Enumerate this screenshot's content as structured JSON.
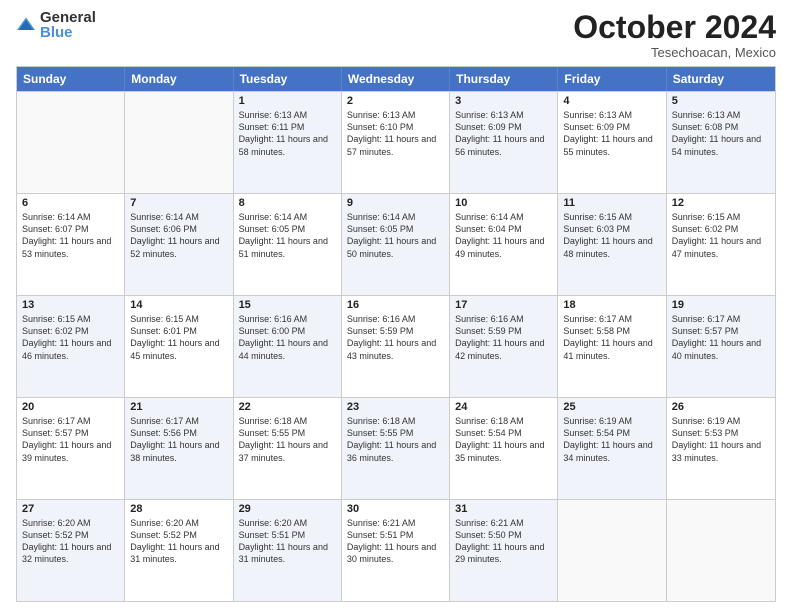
{
  "logo": {
    "general": "General",
    "blue": "Blue"
  },
  "title": "October 2024",
  "subtitle": "Tesechoacan, Mexico",
  "days": [
    "Sunday",
    "Monday",
    "Tuesday",
    "Wednesday",
    "Thursday",
    "Friday",
    "Saturday"
  ],
  "weeks": [
    [
      {
        "day": "",
        "sunrise": "",
        "sunset": "",
        "daylight": "",
        "shaded": false,
        "empty": true
      },
      {
        "day": "",
        "sunrise": "",
        "sunset": "",
        "daylight": "",
        "shaded": false,
        "empty": true
      },
      {
        "day": "1",
        "sunrise": "Sunrise: 6:13 AM",
        "sunset": "Sunset: 6:11 PM",
        "daylight": "Daylight: 11 hours and 58 minutes.",
        "shaded": true,
        "empty": false
      },
      {
        "day": "2",
        "sunrise": "Sunrise: 6:13 AM",
        "sunset": "Sunset: 6:10 PM",
        "daylight": "Daylight: 11 hours and 57 minutes.",
        "shaded": false,
        "empty": false
      },
      {
        "day": "3",
        "sunrise": "Sunrise: 6:13 AM",
        "sunset": "Sunset: 6:09 PM",
        "daylight": "Daylight: 11 hours and 56 minutes.",
        "shaded": true,
        "empty": false
      },
      {
        "day": "4",
        "sunrise": "Sunrise: 6:13 AM",
        "sunset": "Sunset: 6:09 PM",
        "daylight": "Daylight: 11 hours and 55 minutes.",
        "shaded": false,
        "empty": false
      },
      {
        "day": "5",
        "sunrise": "Sunrise: 6:13 AM",
        "sunset": "Sunset: 6:08 PM",
        "daylight": "Daylight: 11 hours and 54 minutes.",
        "shaded": true,
        "empty": false
      }
    ],
    [
      {
        "day": "6",
        "sunrise": "Sunrise: 6:14 AM",
        "sunset": "Sunset: 6:07 PM",
        "daylight": "Daylight: 11 hours and 53 minutes.",
        "shaded": false,
        "empty": false
      },
      {
        "day": "7",
        "sunrise": "Sunrise: 6:14 AM",
        "sunset": "Sunset: 6:06 PM",
        "daylight": "Daylight: 11 hours and 52 minutes.",
        "shaded": true,
        "empty": false
      },
      {
        "day": "8",
        "sunrise": "Sunrise: 6:14 AM",
        "sunset": "Sunset: 6:05 PM",
        "daylight": "Daylight: 11 hours and 51 minutes.",
        "shaded": false,
        "empty": false
      },
      {
        "day": "9",
        "sunrise": "Sunrise: 6:14 AM",
        "sunset": "Sunset: 6:05 PM",
        "daylight": "Daylight: 11 hours and 50 minutes.",
        "shaded": true,
        "empty": false
      },
      {
        "day": "10",
        "sunrise": "Sunrise: 6:14 AM",
        "sunset": "Sunset: 6:04 PM",
        "daylight": "Daylight: 11 hours and 49 minutes.",
        "shaded": false,
        "empty": false
      },
      {
        "day": "11",
        "sunrise": "Sunrise: 6:15 AM",
        "sunset": "Sunset: 6:03 PM",
        "daylight": "Daylight: 11 hours and 48 minutes.",
        "shaded": true,
        "empty": false
      },
      {
        "day": "12",
        "sunrise": "Sunrise: 6:15 AM",
        "sunset": "Sunset: 6:02 PM",
        "daylight": "Daylight: 11 hours and 47 minutes.",
        "shaded": false,
        "empty": false
      }
    ],
    [
      {
        "day": "13",
        "sunrise": "Sunrise: 6:15 AM",
        "sunset": "Sunset: 6:02 PM",
        "daylight": "Daylight: 11 hours and 46 minutes.",
        "shaded": true,
        "empty": false
      },
      {
        "day": "14",
        "sunrise": "Sunrise: 6:15 AM",
        "sunset": "Sunset: 6:01 PM",
        "daylight": "Daylight: 11 hours and 45 minutes.",
        "shaded": false,
        "empty": false
      },
      {
        "day": "15",
        "sunrise": "Sunrise: 6:16 AM",
        "sunset": "Sunset: 6:00 PM",
        "daylight": "Daylight: 11 hours and 44 minutes.",
        "shaded": true,
        "empty": false
      },
      {
        "day": "16",
        "sunrise": "Sunrise: 6:16 AM",
        "sunset": "Sunset: 5:59 PM",
        "daylight": "Daylight: 11 hours and 43 minutes.",
        "shaded": false,
        "empty": false
      },
      {
        "day": "17",
        "sunrise": "Sunrise: 6:16 AM",
        "sunset": "Sunset: 5:59 PM",
        "daylight": "Daylight: 11 hours and 42 minutes.",
        "shaded": true,
        "empty": false
      },
      {
        "day": "18",
        "sunrise": "Sunrise: 6:17 AM",
        "sunset": "Sunset: 5:58 PM",
        "daylight": "Daylight: 11 hours and 41 minutes.",
        "shaded": false,
        "empty": false
      },
      {
        "day": "19",
        "sunrise": "Sunrise: 6:17 AM",
        "sunset": "Sunset: 5:57 PM",
        "daylight": "Daylight: 11 hours and 40 minutes.",
        "shaded": true,
        "empty": false
      }
    ],
    [
      {
        "day": "20",
        "sunrise": "Sunrise: 6:17 AM",
        "sunset": "Sunset: 5:57 PM",
        "daylight": "Daylight: 11 hours and 39 minutes.",
        "shaded": false,
        "empty": false
      },
      {
        "day": "21",
        "sunrise": "Sunrise: 6:17 AM",
        "sunset": "Sunset: 5:56 PM",
        "daylight": "Daylight: 11 hours and 38 minutes.",
        "shaded": true,
        "empty": false
      },
      {
        "day": "22",
        "sunrise": "Sunrise: 6:18 AM",
        "sunset": "Sunset: 5:55 PM",
        "daylight": "Daylight: 11 hours and 37 minutes.",
        "shaded": false,
        "empty": false
      },
      {
        "day": "23",
        "sunrise": "Sunrise: 6:18 AM",
        "sunset": "Sunset: 5:55 PM",
        "daylight": "Daylight: 11 hours and 36 minutes.",
        "shaded": true,
        "empty": false
      },
      {
        "day": "24",
        "sunrise": "Sunrise: 6:18 AM",
        "sunset": "Sunset: 5:54 PM",
        "daylight": "Daylight: 11 hours and 35 minutes.",
        "shaded": false,
        "empty": false
      },
      {
        "day": "25",
        "sunrise": "Sunrise: 6:19 AM",
        "sunset": "Sunset: 5:54 PM",
        "daylight": "Daylight: 11 hours and 34 minutes.",
        "shaded": true,
        "empty": false
      },
      {
        "day": "26",
        "sunrise": "Sunrise: 6:19 AM",
        "sunset": "Sunset: 5:53 PM",
        "daylight": "Daylight: 11 hours and 33 minutes.",
        "shaded": false,
        "empty": false
      }
    ],
    [
      {
        "day": "27",
        "sunrise": "Sunrise: 6:20 AM",
        "sunset": "Sunset: 5:52 PM",
        "daylight": "Daylight: 11 hours and 32 minutes.",
        "shaded": true,
        "empty": false
      },
      {
        "day": "28",
        "sunrise": "Sunrise: 6:20 AM",
        "sunset": "Sunset: 5:52 PM",
        "daylight": "Daylight: 11 hours and 31 minutes.",
        "shaded": false,
        "empty": false
      },
      {
        "day": "29",
        "sunrise": "Sunrise: 6:20 AM",
        "sunset": "Sunset: 5:51 PM",
        "daylight": "Daylight: 11 hours and 31 minutes.",
        "shaded": true,
        "empty": false
      },
      {
        "day": "30",
        "sunrise": "Sunrise: 6:21 AM",
        "sunset": "Sunset: 5:51 PM",
        "daylight": "Daylight: 11 hours and 30 minutes.",
        "shaded": false,
        "empty": false
      },
      {
        "day": "31",
        "sunrise": "Sunrise: 6:21 AM",
        "sunset": "Sunset: 5:50 PM",
        "daylight": "Daylight: 11 hours and 29 minutes.",
        "shaded": true,
        "empty": false
      },
      {
        "day": "",
        "sunrise": "",
        "sunset": "",
        "daylight": "",
        "shaded": false,
        "empty": true
      },
      {
        "day": "",
        "sunrise": "",
        "sunset": "",
        "daylight": "",
        "shaded": false,
        "empty": true
      }
    ]
  ]
}
